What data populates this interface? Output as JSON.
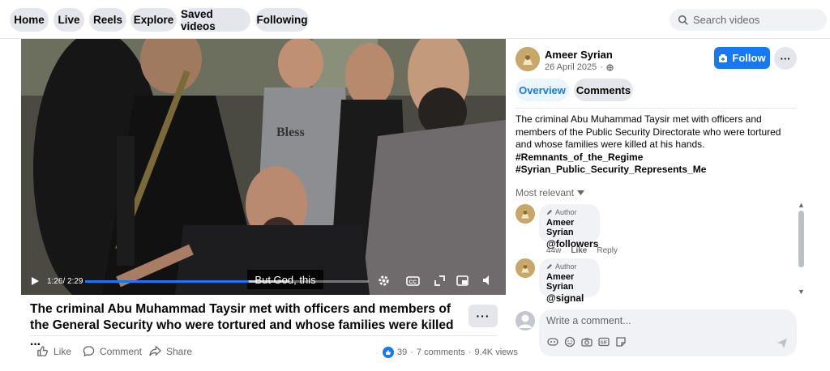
{
  "nav": {
    "tabs": [
      "Home",
      "Live",
      "Reels",
      "Explore",
      "Saved videos",
      "Following"
    ],
    "search_placeholder": "Search videos"
  },
  "video": {
    "subtitle": "But God, this",
    "time": "1:26/ 2:29",
    "progress_fraction": 0.577,
    "buffered_fraction": 0.72,
    "icons": [
      "play-icon",
      "settings-icon",
      "captions-icon",
      "expand-icon",
      "miniplayer-icon",
      "volume-icon"
    ]
  },
  "post": {
    "title_line1": "The criminal Abu Muhammad Taysir met with officers and members of",
    "title_line2": "the General Security who were tortured and whose families were killed ...",
    "more_label": "···",
    "actions": {
      "like": "Like",
      "comment": "Comment",
      "share": "Share"
    },
    "reaction_count": "39",
    "comments_count": "7 comments",
    "views": "9.4K views",
    "separator": "·"
  },
  "author": {
    "name": "Ameer Syrian",
    "date": "26 April 2025",
    "date_sep": "·",
    "follow_label": "Follow",
    "more_label": "···"
  },
  "tabs": {
    "overview": "Overview",
    "comments": "Comments"
  },
  "caption": {
    "text": "The criminal Abu Muhammad Taysir met with officers and members of the Public Security Directorate who were tortured and whose families were killed at his hands.",
    "hashtag1": "#Remnants_of_the_Regime",
    "hashtag2": "#Syrian_Public_Security_Represents_Me"
  },
  "comments_section": {
    "sort_label": "Most relevant",
    "comments": [
      {
        "badge": "Author",
        "name": "Ameer Syrian",
        "text": "@followers",
        "age": "44w",
        "like": "Like",
        "reply": "Reply"
      },
      {
        "badge": "Author",
        "name": "Ameer Syrian",
        "text": "@signal"
      }
    ],
    "write_placeholder": "Write a comment..."
  },
  "colors": {
    "accent": "#1877f2",
    "pill_bg": "#e4e6eb",
    "muted": "#65676b"
  }
}
